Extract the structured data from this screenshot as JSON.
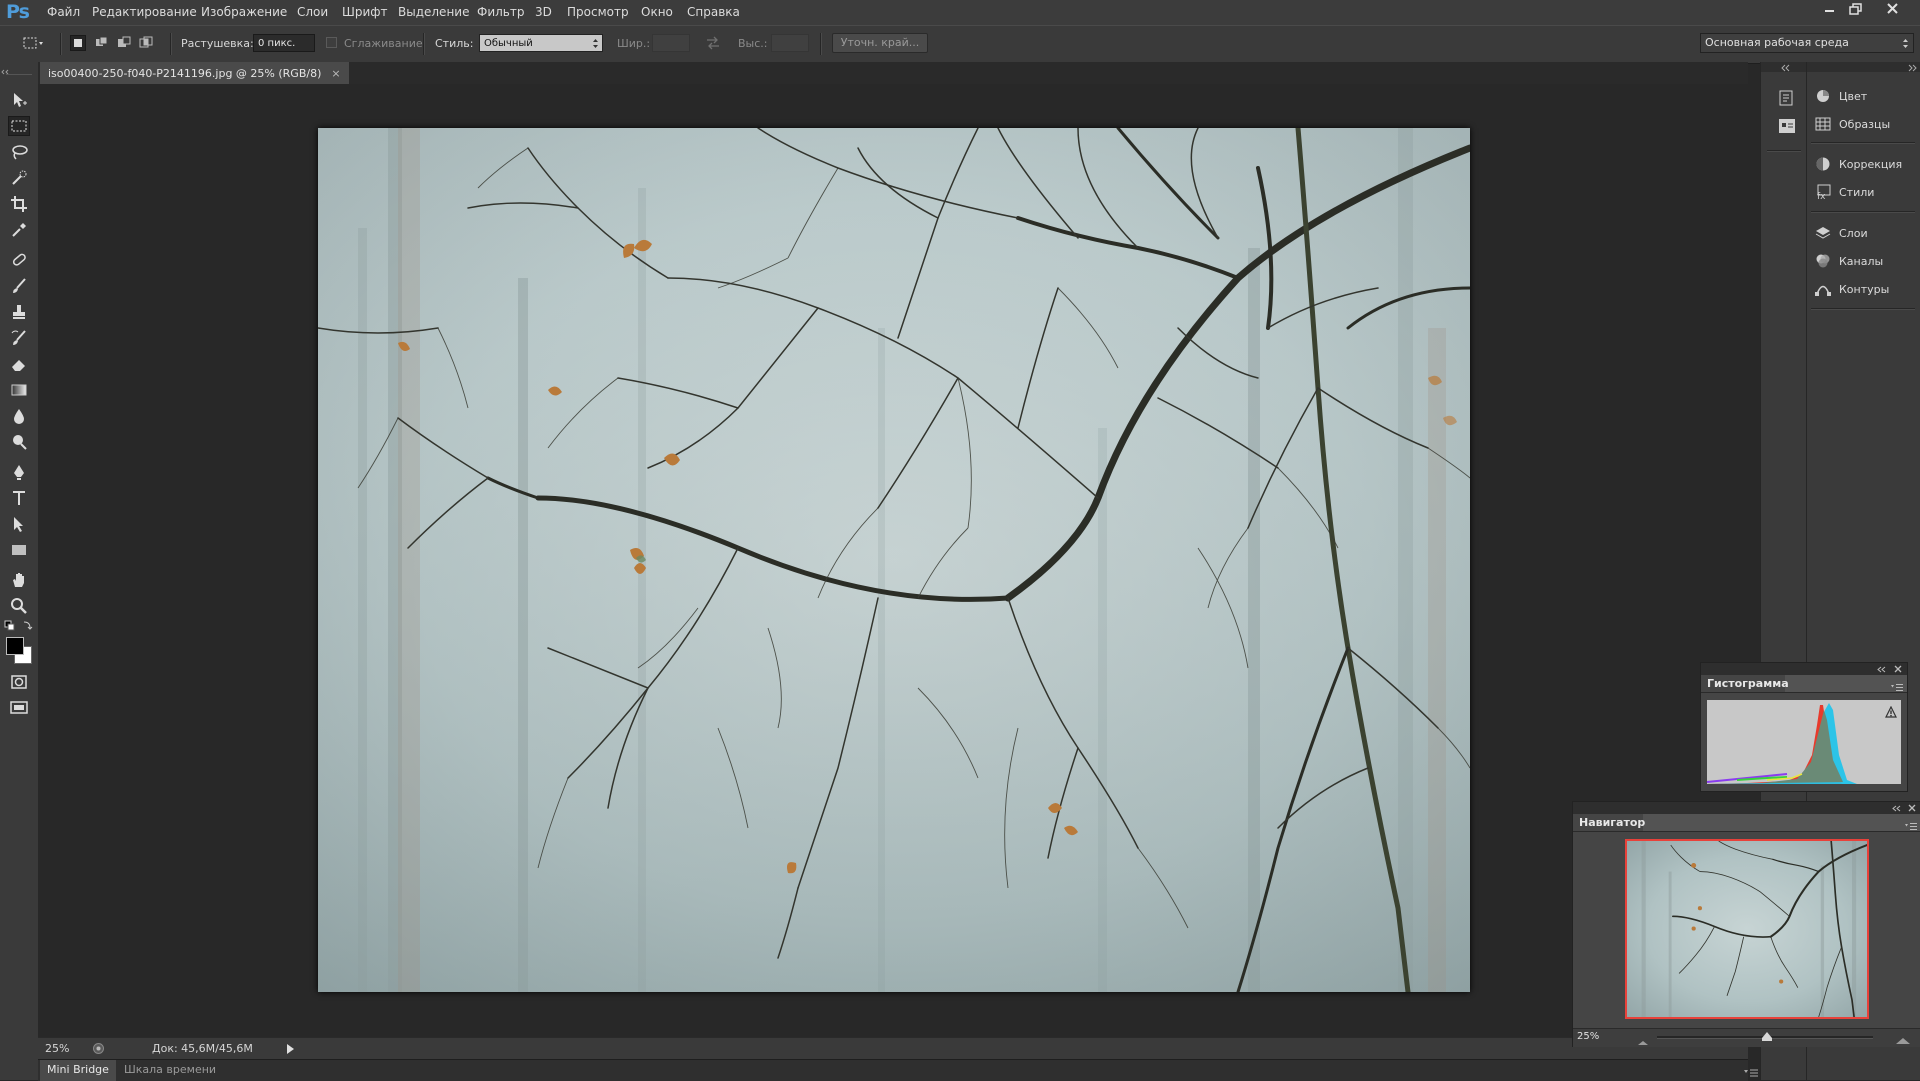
{
  "app": {
    "logo": "Ps",
    "menu": [
      "Файл",
      "Редактирование",
      "Изображение",
      "Слои",
      "Шрифт",
      "Выделение",
      "Фильтр",
      "3D",
      "Просмотр",
      "Окно",
      "Справка"
    ],
    "window_controls": [
      "minimize",
      "restore",
      "close"
    ]
  },
  "options_bar": {
    "feather_label": "Растушевка:",
    "feather_value": "0 пикс.",
    "antialias_label": "Сглаживание",
    "style_label": "Стиль:",
    "style_value": "Обычный",
    "width_label": "Шир.:",
    "height_label": "Выс.:",
    "refine_edge_label": "Уточн. край...",
    "workspace_value": "Основная рабочая среда"
  },
  "document": {
    "tab_title": "iso00400-250-f040-P2141196.jpg @ 25% (RGB/8)",
    "tab_close": "×"
  },
  "status": {
    "zoom": "25%",
    "doc_info": "Док: 45,6M/45,6M"
  },
  "bottom_tabs": {
    "mini_bridge": "Mini Bridge",
    "timeline": "Шкала времени"
  },
  "dock": {
    "groups": [
      [
        "Цвет",
        "Образцы"
      ],
      [
        "Коррекция",
        "Стили"
      ],
      [
        "Слои",
        "Каналы",
        "Контуры"
      ]
    ]
  },
  "histogram": {
    "title": "Гистограмма"
  },
  "navigator": {
    "title": "Навигатор",
    "zoom": "25%",
    "zoom_level": 0.25
  },
  "colors": {
    "app_bg": "#282828",
    "panel_bg": "#3a3a3a",
    "accent": "#4f9cda",
    "nav_frame": "#e8413a"
  }
}
